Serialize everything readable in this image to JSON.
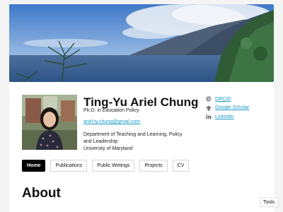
{
  "profile": {
    "name": "Ting-Yu Ariel Chung",
    "subtitle": "Ph.D. in Education Policy",
    "email": "ariel.ty.chung@gmail.com",
    "department": "Department of Teaching and Learning, Policy and Leadership",
    "university": "University of Maryland"
  },
  "links": [
    {
      "label": "ORCID",
      "icon": "orcid-icon"
    },
    {
      "label": "Google Scholar",
      "icon": "google-scholar-icon"
    },
    {
      "label": "LinkedIn",
      "icon": "linkedin-icon"
    }
  ],
  "nav": {
    "items": [
      "Home",
      "Publications",
      "Public Writings",
      "Projects",
      "CV"
    ],
    "active": "Home"
  },
  "main": {
    "heading": "About"
  },
  "tools": {
    "label": "Tools"
  },
  "colors": {
    "link": "#1a9bc8",
    "active_nav": "#000000"
  }
}
